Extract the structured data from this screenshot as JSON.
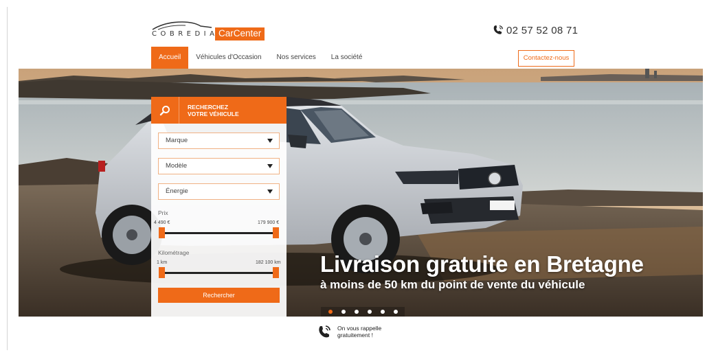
{
  "header": {
    "logo_brand": "COBREDIA",
    "logo_tag": "CarCenter",
    "phone": "02 57 52 08 71",
    "contact_label": "Contactez-nous"
  },
  "nav": {
    "items": [
      {
        "label": "Accueil",
        "active": true
      },
      {
        "label": "Véhicules d'Occasion",
        "active": false
      },
      {
        "label": "Nos services",
        "active": false
      },
      {
        "label": "La société",
        "active": false
      }
    ]
  },
  "search": {
    "title_line1": "RECHERCHEZ",
    "title_line2": "VOTRE VÉHICULE",
    "marque_placeholder": "Marque",
    "modele_placeholder": "Modèle",
    "energie_placeholder": "Énergie",
    "prix_label": "Prix",
    "prix_min": "4 490 €",
    "prix_max": "179 900 €",
    "km_label": "Kilométrage",
    "km_min": "1 km",
    "km_max": "182 100 km",
    "button_label": "Rechercher"
  },
  "hero": {
    "title": "Livraison gratuite en Bretagne",
    "subtitle": "à moins de 50 km du point de vente du véhicule",
    "slide_count": 6,
    "active_slide": 1
  },
  "callback": {
    "line1": "On vous rappelle",
    "line2": "gratuitement !"
  },
  "colors": {
    "accent": "#ef6a18",
    "header_bg": "#ffffff"
  },
  "icons": [
    "phone-icon",
    "search-icon",
    "caret-down-icon",
    "callback-phone-icon",
    "car-logo-icon"
  ]
}
